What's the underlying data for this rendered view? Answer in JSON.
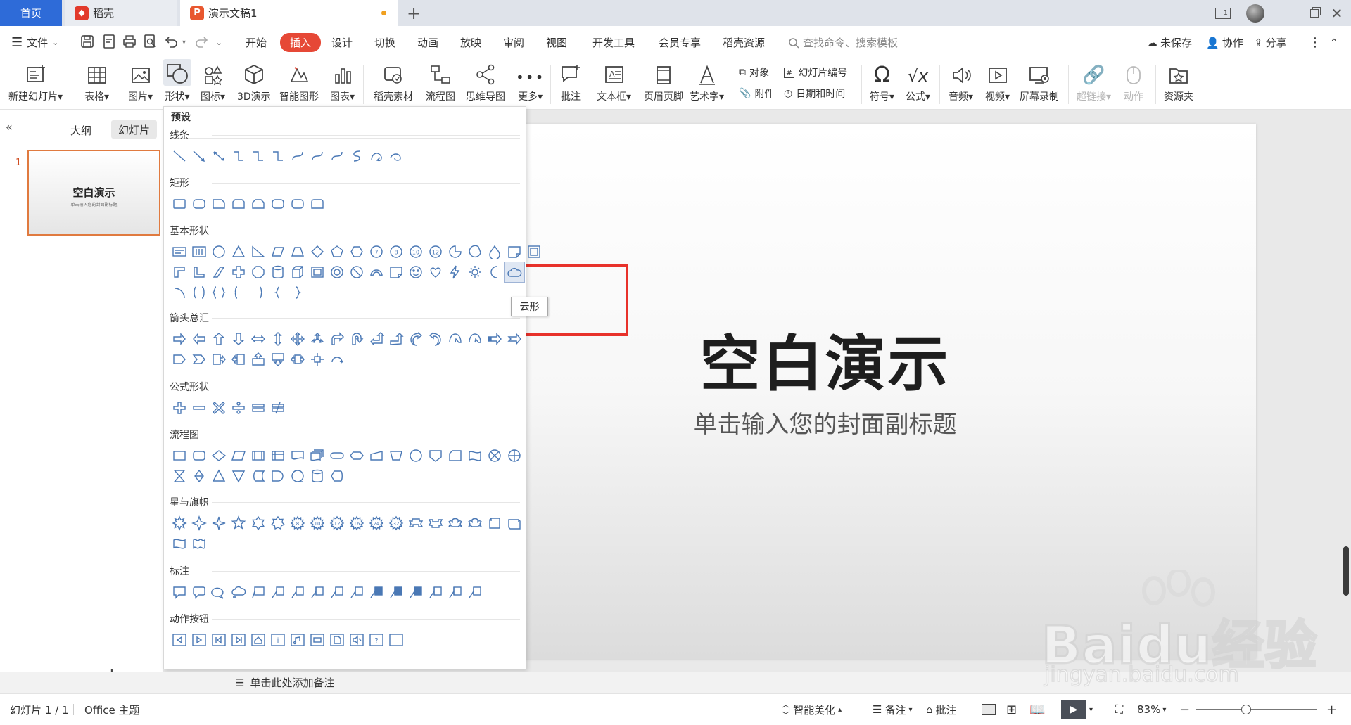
{
  "tabs": {
    "home": "首页",
    "docer": "稻壳",
    "presentation": "演示文稿1",
    "presentation_icon_letter": "P"
  },
  "window_controls": {
    "badge": "1"
  },
  "menu": {
    "file": "文件",
    "items": [
      "开始",
      "插入",
      "设计",
      "切换",
      "动画",
      "放映",
      "审阅",
      "视图",
      "开发工具",
      "会员专享",
      "稻壳资源"
    ],
    "search_placeholder": "查找命令、搜索模板",
    "unsaved": "未保存",
    "collaborate": "协作",
    "share": "分享"
  },
  "ribbon": {
    "new_slide": "新建幻灯片",
    "table": "表格",
    "picture": "图片",
    "shape": "形状",
    "icon": "图标",
    "demo3d": "3D演示",
    "smartart": "智能图形",
    "chart": "图表",
    "docer_material": "稻壳素材",
    "flowchart": "流程图",
    "mindmap": "思维导图",
    "more": "更多",
    "comment": "批注",
    "textbox": "文本框",
    "header_footer": "页眉页脚",
    "wordart": "艺术字",
    "object": "对象",
    "slide_number": "幻灯片编号",
    "attachment": "附件",
    "date_time": "日期和时间",
    "symbol": "符号",
    "formula": "公式",
    "audio": "音频",
    "video": "视频",
    "screen_record": "屏幕录制",
    "hyperlink": "超链接",
    "action": "动作",
    "resource": "资源夹"
  },
  "left_pane": {
    "outline_tab": "大纲",
    "slides_tab": "幻灯片",
    "slide_number": "1",
    "thumb_title": "空白演示",
    "thumb_subtitle": "单击输入您的封面副标题",
    "add": "+"
  },
  "shape_panel": {
    "preset": "预设",
    "sections": [
      "线条",
      "矩形",
      "基本形状",
      "箭头总汇",
      "公式形状",
      "流程图",
      "星与旗帜",
      "标注",
      "动作按钮"
    ],
    "tooltip": "云形"
  },
  "slide": {
    "title": "空白演示",
    "subtitle": "单击输入您的封面副标题"
  },
  "notes": {
    "placeholder": "单击此处添加备注"
  },
  "status": {
    "slide_count": "幻灯片 1 / 1",
    "theme": "Office 主题",
    "smart_beautify": "智能美化",
    "notes": "备注",
    "comments": "批注",
    "zoom": "83%"
  },
  "watermark": {
    "brand": "Baidu经验",
    "url": "jingyan.baidu.com"
  },
  "colors": {
    "accent_blue": "#2e6bd8",
    "insert_tab": "#e64836",
    "shape_stroke": "#4a78b5",
    "highlight_red": "#e8322b"
  }
}
